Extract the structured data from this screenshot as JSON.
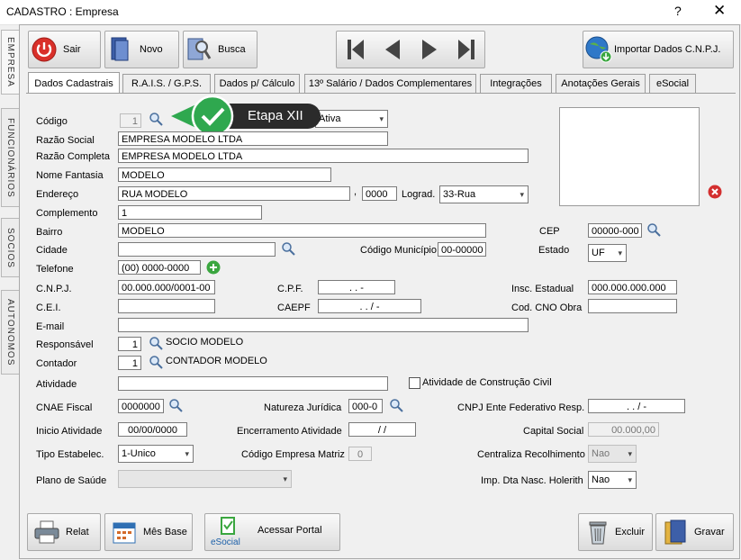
{
  "window": {
    "title": "CADASTRO : Empresa",
    "help": "?",
    "close": "✕"
  },
  "side_tabs": [
    "EMPRESA",
    "FUNCIONÁRIOS",
    "SOCIOS",
    "AUTONOMOS"
  ],
  "toolbar": {
    "sair": "Sair",
    "novo": "Novo",
    "busca": "Busca",
    "importar": "Importar Dados C.N.P.J."
  },
  "tabs": [
    "Dados Cadastrais",
    "R.A.I.S. / G.P.S.",
    "Dados p/ Cálculo",
    "13º Salário / Dados Complementares",
    "Integrações",
    "Anotações Gerais",
    "eSocial"
  ],
  "badge": {
    "text": "Etapa XII"
  },
  "form": {
    "codigo": {
      "label": "Código",
      "value": "1"
    },
    "status": {
      "value": "Ativa"
    },
    "razao_social": {
      "label": "Razão Social",
      "value": "EMPRESA MODELO LTDA"
    },
    "razao_completa": {
      "label": "Razão Completa",
      "value": "EMPRESA MODELO LTDA"
    },
    "nome_fantasia": {
      "label": "Nome Fantasia",
      "value": "MODELO"
    },
    "endereco": {
      "label": "Endereço",
      "value": "RUA MODELO",
      "sep": ",",
      "numero": "0000"
    },
    "lograd": {
      "label": "Lograd.",
      "value": "33-Rua"
    },
    "complemento": {
      "label": "Complemento",
      "value": "1"
    },
    "bairro": {
      "label": "Bairro",
      "value": "MODELO"
    },
    "cep": {
      "label": "CEP",
      "value": "00000-000"
    },
    "cidade": {
      "label": "Cidade",
      "value": ""
    },
    "codigo_municipio": {
      "label": "Código Município",
      "value": "00-00000"
    },
    "estado": {
      "label": "Estado",
      "value": "UF"
    },
    "telefone": {
      "label": "Telefone",
      "value": "(00) 0000-0000"
    },
    "cnpj": {
      "label": "C.N.P.J.",
      "value": "00.000.000/0001-00"
    },
    "cpf": {
      "label": "C.P.F.",
      "value": " .  .  -"
    },
    "insc_estadual": {
      "label": "Insc. Estadual",
      "value": "000.000.000.000"
    },
    "cei": {
      "label": "C.E.I.",
      "value": ""
    },
    "caepf": {
      "label": "CAEPF",
      "value": " .  .  /  -"
    },
    "cod_cno": {
      "label": "Cod. CNO Obra",
      "value": ""
    },
    "email": {
      "label": "E-mail",
      "value": ""
    },
    "responsavel": {
      "label": "Responsável",
      "value": "1",
      "name": "SOCIO MODELO"
    },
    "contador": {
      "label": "Contador",
      "value": "1",
      "name": "CONTADOR MODELO"
    },
    "atividade": {
      "label": "Atividade",
      "value": ""
    },
    "atividade_construcao": {
      "label": "Atividade de Construção Civil"
    },
    "cnae": {
      "label": "CNAE Fiscal",
      "value": "0000000"
    },
    "natureza": {
      "label": "Natureza Jurídica",
      "value": "000-0"
    },
    "cnpj_ente": {
      "label": "CNPJ Ente Federativo Resp.",
      "value": " .  .  /  -"
    },
    "inicio": {
      "label": "Inicio Atividade",
      "value": "00/00/0000"
    },
    "encerramento": {
      "label": "Encerramento Atividade",
      "value": " / /"
    },
    "capital": {
      "label": "Capital Social",
      "value": "00.000,00"
    },
    "tipo_estab": {
      "label": "Tipo Estabelec.",
      "value": "1-Unico"
    },
    "cod_matriz": {
      "label": "Código Empresa Matriz",
      "value": "0"
    },
    "centraliza": {
      "label": "Centraliza Recolhimento",
      "value": "Nao"
    },
    "plano_saude": {
      "label": "Plano de Saúde",
      "value": ""
    },
    "imp_dta": {
      "label": "Imp. Dta Nasc. Holerith",
      "value": "Nao"
    }
  },
  "bottom": {
    "relat": "Relat",
    "mes_base": "Mês Base",
    "esocial_logo": "eSocial",
    "acessar": "Acessar Portal",
    "excluir": "Excluir",
    "gravar": "Gravar"
  },
  "colors": {
    "badge_green": "#2fa84f",
    "badge_dark": "#2b2b2b",
    "close_red": "#d32f2f"
  }
}
